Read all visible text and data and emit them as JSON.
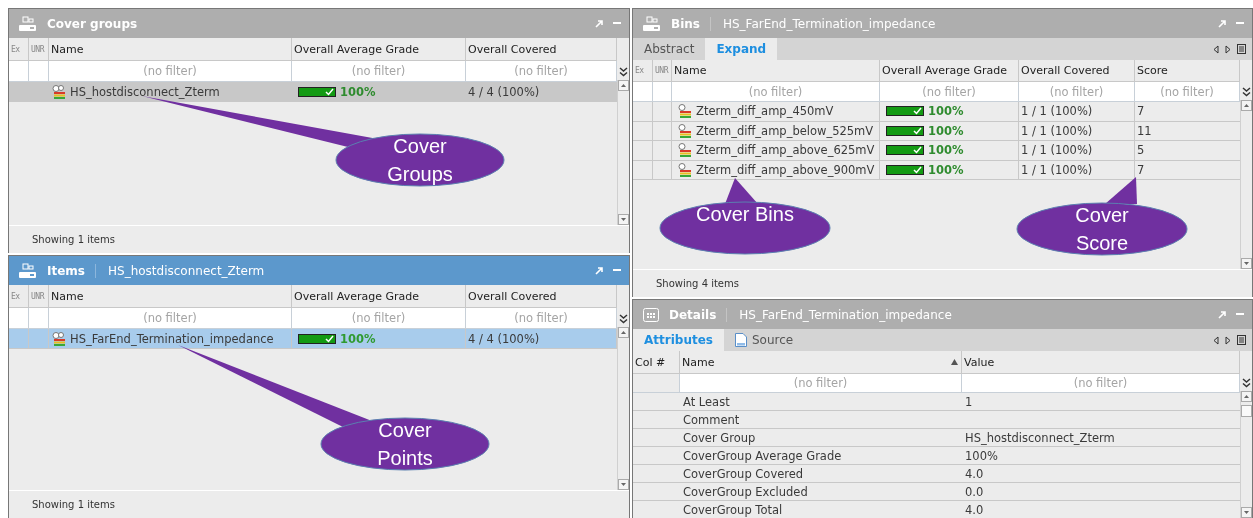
{
  "cover_groups": {
    "title": "Cover groups",
    "active": false,
    "columns": [
      "Ex",
      "UNR",
      "Name",
      "Overall Average Grade",
      "Overall Covered"
    ],
    "filters": [
      "(no filter)",
      "(no filter)",
      "(no filter)"
    ],
    "rows": [
      {
        "name": "HS_hostdisconnect_Zterm",
        "grade": "100%",
        "level": 1,
        "covered": "4 / 4 (100%)",
        "selected": true
      }
    ],
    "status": "Showing 1 items"
  },
  "items": {
    "title": "Items",
    "subtitle": "HS_hostdisconnect_Zterm",
    "active": true,
    "columns": [
      "Ex",
      "UNR",
      "Name",
      "Overall Average Grade",
      "Overall Covered"
    ],
    "filters": [
      "(no filter)",
      "(no filter)",
      "(no filter)"
    ],
    "rows": [
      {
        "name": "HS_FarEnd_Termination_impedance",
        "grade": "100%",
        "level": 1,
        "covered": "4 / 4 (100%)",
        "selected": true
      }
    ],
    "status": "Showing 1 items"
  },
  "bins": {
    "title": "Bins",
    "subtitle": "HS_FarEnd_Termination_impedance",
    "active": false,
    "tabs": [
      {
        "label": "Abstract",
        "selected": false
      },
      {
        "label": "Expand",
        "selected": true
      }
    ],
    "columns": [
      "Ex",
      "UNR",
      "Name",
      "Overall Average Grade",
      "Overall Covered",
      "Score"
    ],
    "filters": [
      "(no filter)",
      "(no filter)",
      "(no filter)",
      "(no filter)"
    ],
    "rows": [
      {
        "name": "Zterm_diff_amp_450mV",
        "grade": "100%",
        "level": 1,
        "covered": "1 / 1 (100%)",
        "score": "7",
        "selected": false
      },
      {
        "name": "Zterm_diff_amp_below_525mV",
        "grade": "100%",
        "level": 1,
        "covered": "1 / 1 (100%)",
        "score": "11",
        "selected": false
      },
      {
        "name": "Zterm_diff_amp_above_625mV",
        "grade": "100%",
        "level": 1,
        "covered": "1 / 1 (100%)",
        "score": "5",
        "selected": false
      },
      {
        "name": "Zterm_diff_amp_above_900mV",
        "grade": "100%",
        "level": 1,
        "covered": "1 / 1 (100%)",
        "score": "7",
        "selected": false
      }
    ],
    "status": "Showing 4 items"
  },
  "details": {
    "title": "Details",
    "subtitle": "HS_FarEnd_Termination_impedance",
    "active": false,
    "tabs": [
      {
        "label": "Attributes",
        "selected": true,
        "kind": "plain"
      },
      {
        "label": "Source",
        "selected": false,
        "kind": "document"
      }
    ],
    "columns": [
      "Col #",
      "Name",
      "Value"
    ],
    "filters": [
      "(no filter)",
      "(no filter)"
    ],
    "rows": [
      {
        "name": "At Least",
        "value": "1"
      },
      {
        "name": "Comment"
      },
      {
        "name": "Cover Group",
        "value": "HS_hostdisconnect_Zterm"
      },
      {
        "name": "CoverGroup Average Grade",
        "value": "100%"
      },
      {
        "name": "CoverGroup Covered",
        "value": "4.0"
      },
      {
        "name": "CoverGroup Excluded",
        "value": "0.0"
      },
      {
        "name": "CoverGroup Total",
        "value": "4.0"
      }
    ]
  },
  "callouts": [
    {
      "text": "Cover Groups"
    },
    {
      "text": "Cover Points"
    },
    {
      "text": "Cover Bins"
    },
    {
      "text": "Cover Score"
    }
  ]
}
